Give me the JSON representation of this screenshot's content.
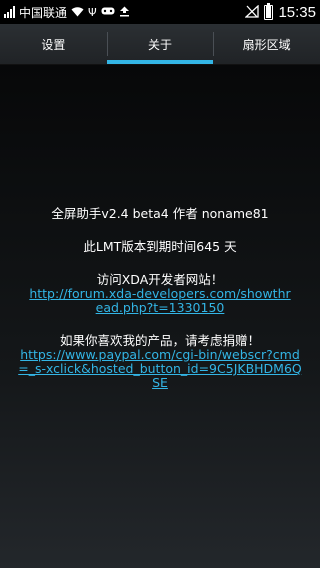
{
  "status_bar": {
    "carrier": "中国联通",
    "time": "15:35",
    "battery_level": 0.95
  },
  "tabs": [
    {
      "label": "设置",
      "active": false
    },
    {
      "label": "关于",
      "active": true
    },
    {
      "label": "扇形区域",
      "active": false
    }
  ],
  "about": {
    "title_line": "全屏助手v2.4 beta4 作者 noname81",
    "expiry_line": "此LMT版本到期时间645 天",
    "forum_prompt": "访问XDA开发者网站！",
    "forum_link": "http://forum.xda-developers.com/showthread.php?t=1330150",
    "donate_prompt": "如果你喜欢我的产品，请考虑捐赠！",
    "donate_link": "https://www.paypal.com/cgi-bin/webscr?cmd=_s-xclick&hosted_button_id=9C5JKBHDM6QSE"
  },
  "colors": {
    "accent": "#33b5e5",
    "link": "#33b5e5"
  }
}
